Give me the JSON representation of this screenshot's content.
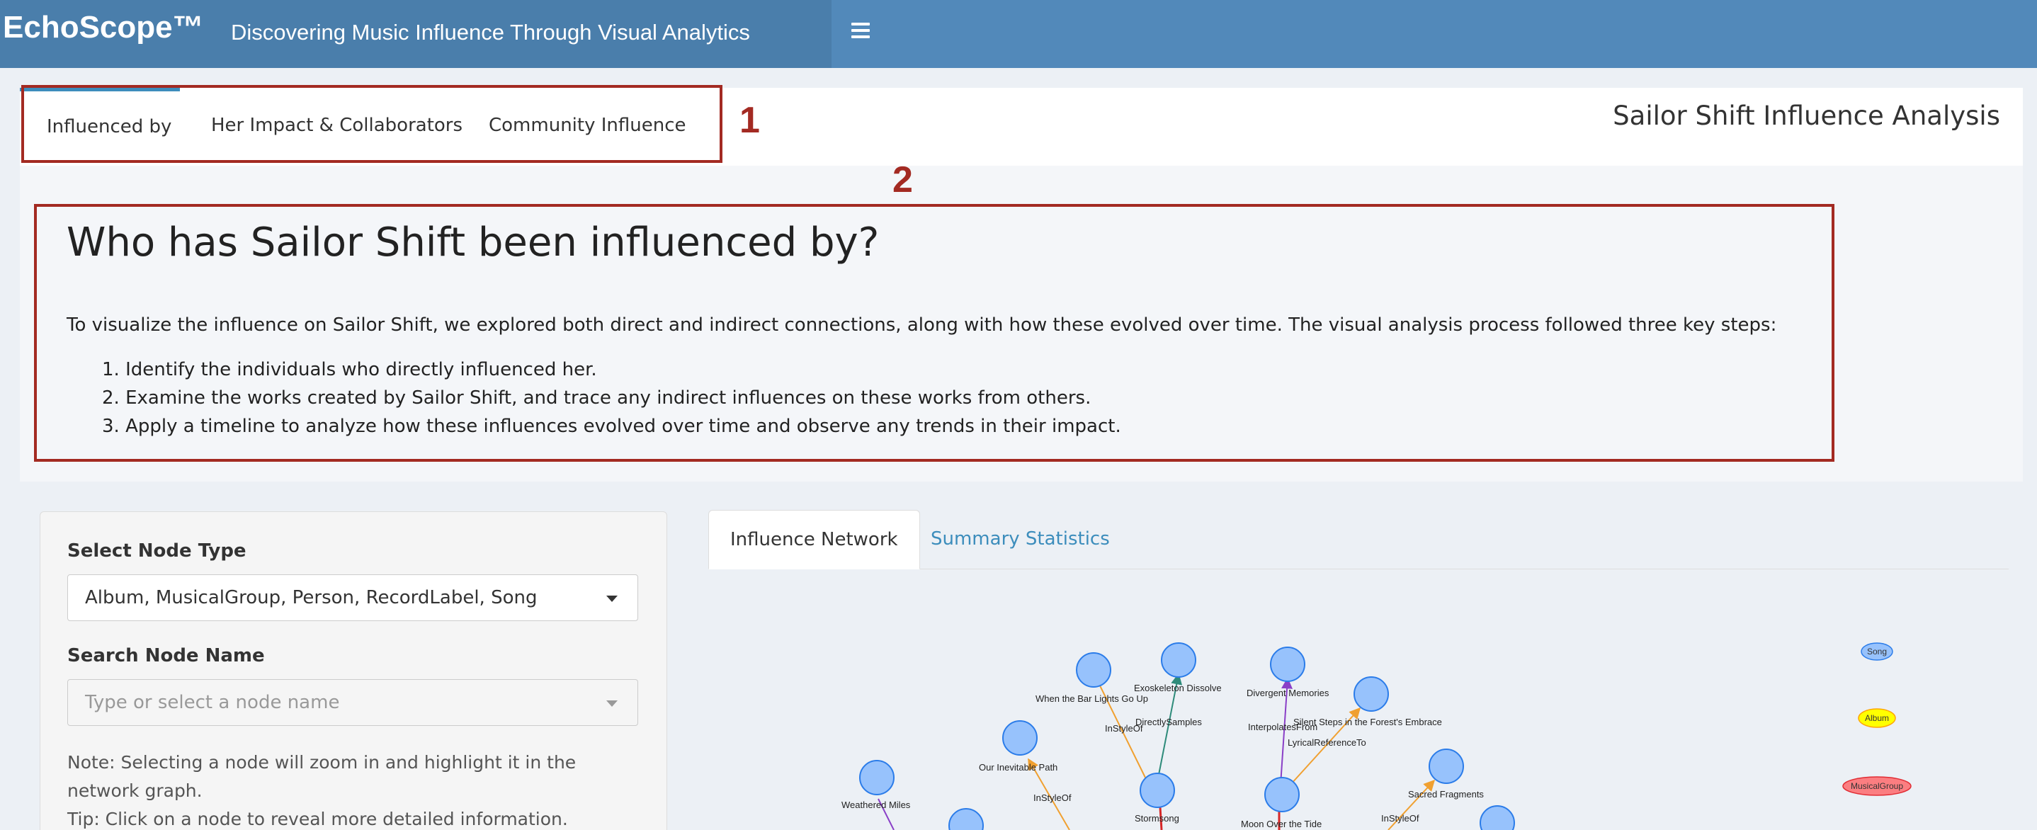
{
  "header": {
    "brand": "EchoScope™",
    "subtitle": "Discovering Music Influence Through Visual Analytics",
    "colors": {
      "logo_bg": "#4a7eab",
      "header_bg": "#5289ba"
    }
  },
  "top_tabs": [
    {
      "label": "Influenced by",
      "active": true
    },
    {
      "label": "Her Impact & Collaborators",
      "active": false
    },
    {
      "label": "Community Influence",
      "active": false
    }
  ],
  "page_title": "Sailor Shift Influence Analysis",
  "annotations": {
    "one": "1",
    "two": "2",
    "color": "#a32a22"
  },
  "intro": {
    "title": "Who has Sailor Shift been influenced by?",
    "text": "To visualize the influence on Sailor Shift, we explored both direct and indirect connections, along with how these evolved over time. The visual analysis process followed three key steps:",
    "steps": [
      "1. Identify the individuals who directly influenced her.",
      "2. Examine the works created by Sailor Shift, and trace any indirect influences on these works from others.",
      "3. Apply a timeline to analyze how these influences evolved over time and observe any trends in their impact."
    ]
  },
  "controls": {
    "node_type_label": "Select Node Type",
    "node_type_value": "Album, MusicalGroup, Person, RecordLabel, Song",
    "search_label": "Search Node Name",
    "search_placeholder": "Type or select a node name",
    "note_line1": "Note: Selecting a node will zoom in and highlight it in the network graph.",
    "note_line2": "Tip: Click on a node to reveal more detailed information."
  },
  "inner_tabs": [
    {
      "label": "Influence Network",
      "active": true
    },
    {
      "label": "Summary Statistics",
      "active": false
    }
  ],
  "graph": {
    "node_labels": {
      "bar_lights": "When the Bar Lights Go Up",
      "exoskeleton": "Exoskeleton Dissolve",
      "divergent": "Divergent Memories",
      "silent_steps": "Silent Steps in the Forest's Embrace",
      "inevitable": "Our Inevitable Path",
      "weathered": "Weathered Miles",
      "stormsong": "Stormsong",
      "moon": "Moon Over the Tide",
      "sacred": "Sacred Fragments"
    },
    "edge_labels": {
      "instyleof_1": "InStyleOf",
      "directlysamples": "DirectlySamples",
      "interpolatesfrom": "InterpolatesFrom",
      "lyricalreferenceto": "LyricalReferenceTo",
      "instyleof_2": "InStyleOf",
      "instyleof_3": "InStyleOf"
    },
    "legend": {
      "song": "Song",
      "album": "Album",
      "musicalgroup": "MusicalGroup"
    },
    "colors": {
      "song_node": "#97c2fc",
      "song_border": "#2b7ce9",
      "album_node": "#ffff00",
      "album_border": "#ffa500",
      "group_node": "#fb7e81",
      "group_border": "#e12d34",
      "edge_orange": "#f0a030",
      "edge_green": "#2e8b7a",
      "edge_purple": "#8a3fc7",
      "edge_red": "#d62728"
    }
  }
}
